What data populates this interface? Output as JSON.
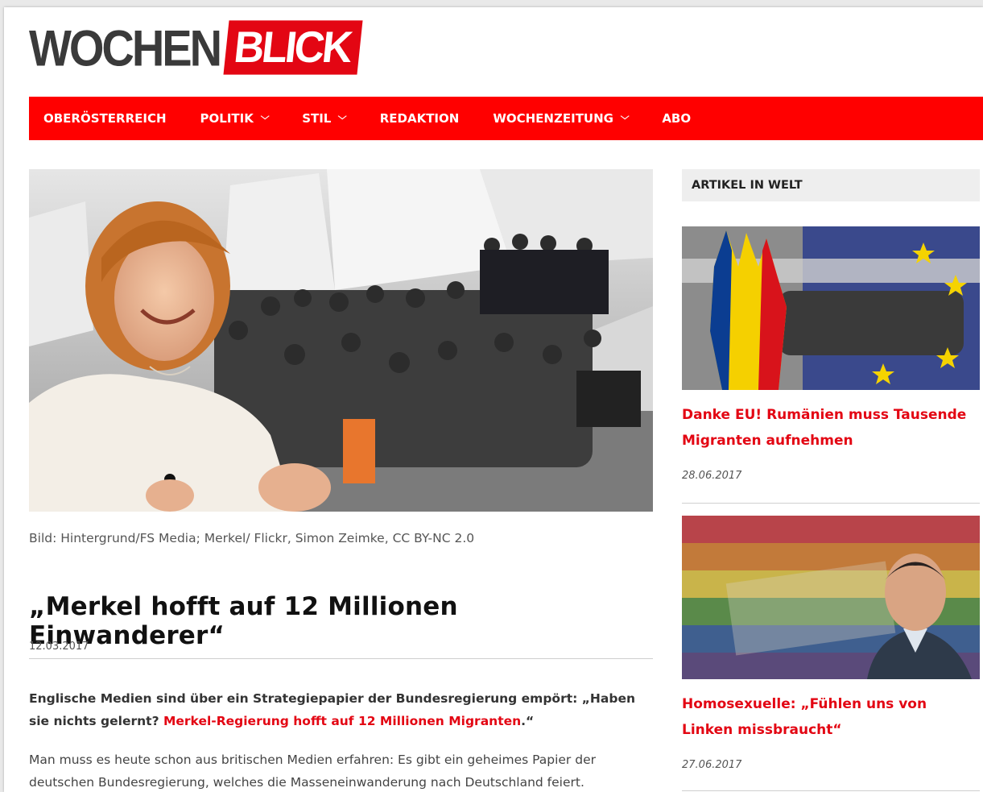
{
  "logo": {
    "part1": "WOCHEN",
    "part2": "BLICK"
  },
  "colors": {
    "brand_red": "#ff0000",
    "link_red": "#e30613"
  },
  "nav": [
    {
      "label": "OBERÖSTERREICH",
      "dropdown": false
    },
    {
      "label": "POLITIK",
      "dropdown": true
    },
    {
      "label": "STIL",
      "dropdown": true
    },
    {
      "label": "REDAKTION",
      "dropdown": false
    },
    {
      "label": "WOCHENZEITUNG",
      "dropdown": true
    },
    {
      "label": "ABO",
      "dropdown": false
    }
  ],
  "article": {
    "image_caption": "Bild: Hintergrund/FS Media; Merkel/ Flickr, Simon Zeimke, CC BY-NC 2.0",
    "title": "„Merkel hofft auf 12 Millionen Einwanderer“",
    "date": "12.03.2017",
    "lead_text": "Englische Medien sind über ein Strategiepapier der Bundesregierung empört: „Haben sie nichts gelernt? ",
    "lead_link": "Merkel-Regierung hofft auf 12 Millionen Migranten",
    "lead_end": ".“",
    "body": "Man muss es heute schon aus britischen Medien erfahren: Es gibt ein geheimes Papier der deutschen Bundesregierung, welches die Masseneinwanderung nach Deutschland feiert."
  },
  "sidebar": {
    "heading": "ARTIKEL IN WELT",
    "items": [
      {
        "title": "Danke EU! Rumänien muss Tausende Migranten aufnehmen",
        "date": "28.06.2017"
      },
      {
        "title": "Homosexuelle: „Fühlen uns von Linken missbraucht“",
        "date": "27.06.2017"
      }
    ]
  },
  "icons": {
    "dropdown": "chevron-down-icon"
  }
}
